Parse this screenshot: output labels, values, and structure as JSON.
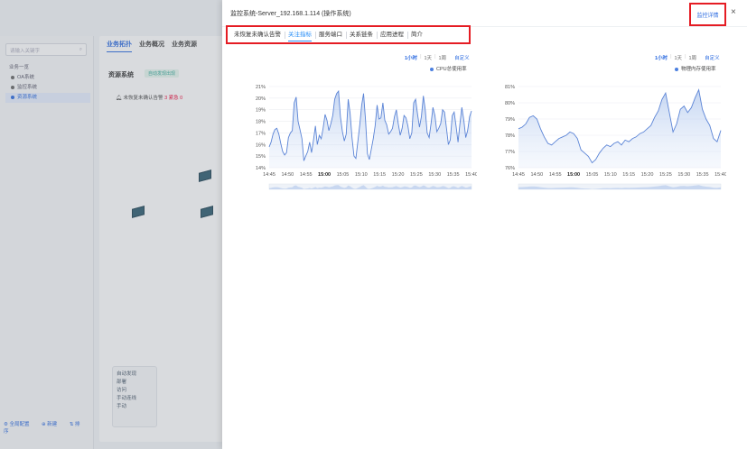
{
  "background": {
    "search_placeholder": "请输入关键字",
    "tree": [
      "业务一览",
      "OA系统",
      "监控系统",
      "资源系统"
    ],
    "bottom_actions": [
      "全局配置",
      "新建",
      "排序"
    ],
    "tabs": [
      "业务拓扑",
      "业务概况",
      "业务资源"
    ],
    "section_title": "资源系统",
    "section_badge": "自动发现出现",
    "alarm_text": "未恢复未确认告警",
    "alarm_count": "3",
    "alarm_sub": "紧急 0",
    "legend": [
      "自动发现",
      "部署",
      "访问",
      "手动连线",
      "手动"
    ]
  },
  "drawer": {
    "title": "监控系统-Server_192.168.1.114 (操作系统)",
    "detail_button": "监控详情",
    "close_glyph": "×",
    "tabs": [
      {
        "label": "未恢复未确认告警",
        "active": false
      },
      {
        "label": "关注指标",
        "active": true
      },
      {
        "label": "服务端口",
        "active": false
      },
      {
        "label": "关系链条",
        "active": false
      },
      {
        "label": "应用进程",
        "active": false
      },
      {
        "label": "简介",
        "active": false
      }
    ],
    "range_options": [
      "1小时",
      "1天",
      "1周"
    ],
    "range_selected": "1小时",
    "range_custom": "自定义"
  },
  "colors": {
    "accent": "#2a8ff7",
    "highlight": "#e51c23",
    "series": "#5b84d6"
  },
  "chart_data": [
    {
      "type": "area",
      "series": [
        {
          "name": "CPU总使用率",
          "values": [
            15.8,
            16.2,
            16.9,
            17.3,
            17.4,
            16.9,
            16.1,
            15.4,
            15.1,
            15.3,
            16.6,
            17.0,
            17.2,
            19.6,
            20.1,
            18.0,
            17.3,
            16.5,
            14.6,
            15.0,
            15.4,
            16.2,
            15.3,
            16.4,
            17.6,
            16.0,
            16.8,
            16.5,
            17.4,
            18.6,
            18.1,
            17.2,
            17.8,
            18.5,
            19.9,
            20.4,
            20.6,
            18.4,
            17.1,
            16.3,
            16.9,
            19.9,
            18.7,
            16.6,
            15.0,
            14.8,
            16.2,
            17.7,
            19.4,
            20.4,
            18.1,
            15.2,
            14.7,
            15.6,
            16.5,
            17.6,
            19.4,
            18.2,
            18.3,
            19.6,
            18.1,
            17.7,
            16.9,
            17.1,
            17.4,
            18.4,
            19.0,
            17.8,
            16.8,
            17.4,
            18.5,
            18.3,
            17.6,
            16.5,
            17.0,
            19.6,
            19.9,
            18.6,
            17.5,
            18.4,
            20.2,
            19.0,
            17.0,
            16.6,
            17.8,
            19.2,
            18.5,
            17.1,
            17.4,
            17.8,
            19.0,
            18.8,
            17.4,
            16.0,
            16.4,
            18.5,
            18.8,
            17.6,
            16.2,
            17.8,
            19.2,
            18.1,
            16.6,
            17.2,
            18.4,
            18.9
          ]
        }
      ],
      "x_ticks": [
        "14:45",
        "14:50",
        "14:55",
        "15:00",
        "15:05",
        "15:10",
        "15:15",
        "15:20",
        "15:25",
        "15:30",
        "15:35",
        "15:40"
      ],
      "y_ticks": [
        "14%",
        "15%",
        "16%",
        "17%",
        "18%",
        "19%",
        "20%",
        "21%"
      ],
      "ylim": [
        14,
        21
      ]
    },
    {
      "type": "area",
      "series": [
        {
          "name": "物理内存使用率",
          "values": [
            78.4,
            78.5,
            78.7,
            79.1,
            79.2,
            79.0,
            78.4,
            77.9,
            77.5,
            77.4,
            77.6,
            77.8,
            77.9,
            78.0,
            78.2,
            78.1,
            77.8,
            77.1,
            76.9,
            76.7,
            76.3,
            76.5,
            76.9,
            77.2,
            77.4,
            77.3,
            77.5,
            77.6,
            77.4,
            77.7,
            77.6,
            77.8,
            77.9,
            78.1,
            78.2,
            78.4,
            78.6,
            79.1,
            79.5,
            80.2,
            80.6,
            79.4,
            78.2,
            78.7,
            79.6,
            79.8,
            79.4,
            79.7,
            80.3,
            80.8,
            79.6,
            79.0,
            78.6,
            77.8,
            77.6,
            78.3
          ]
        }
      ],
      "x_ticks": [
        "14:45",
        "14:50",
        "14:55",
        "15:00",
        "15:05",
        "15:10",
        "15:15",
        "15:20",
        "15:25",
        "15:30",
        "15:35",
        "15:40"
      ],
      "y_ticks": [
        "76%",
        "77%",
        "78%",
        "79%",
        "80%",
        "81%"
      ],
      "ylim": [
        76,
        81
      ]
    }
  ]
}
